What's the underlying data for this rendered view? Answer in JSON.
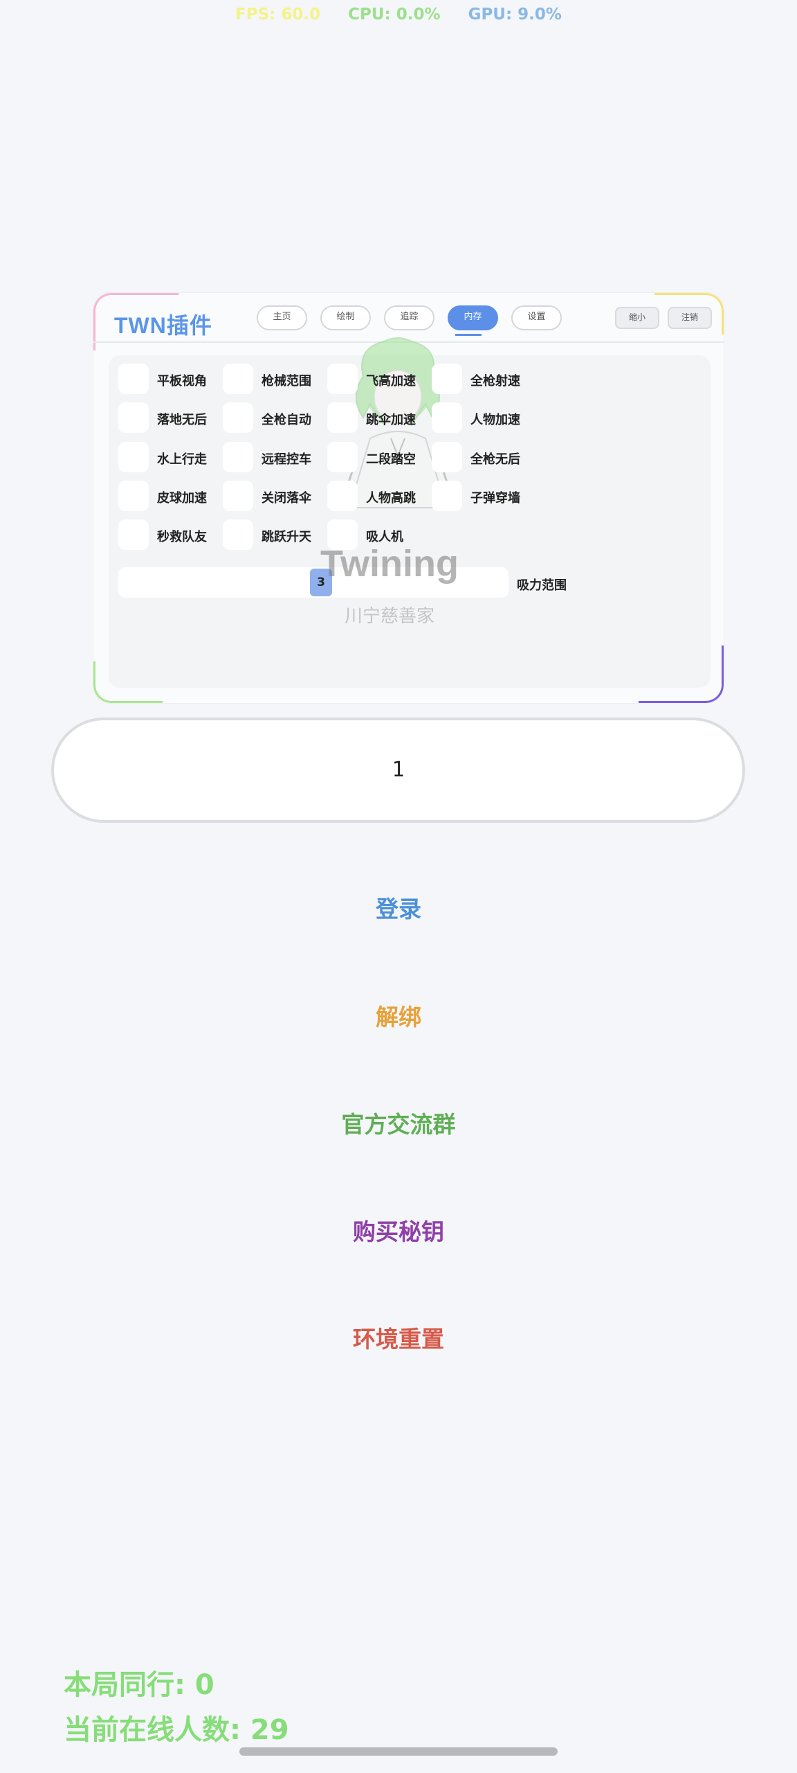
{
  "stats": {
    "fps": "FPS: 60.0",
    "cpu": "CPU: 0.0%",
    "gpu": "GPU: 9.0%"
  },
  "panel": {
    "logo": "TWN插件",
    "tabs": [
      "主页",
      "绘制",
      "追踪",
      "内存",
      "设置"
    ],
    "active_tab": "内存",
    "minimize_label": "缩小",
    "logout_label": "注销",
    "features": [
      [
        "平板视角",
        "枪械范围",
        "飞高加速",
        "全枪射速"
      ],
      [
        "落地无后",
        "全枪自动",
        "跳伞加速",
        "人物加速"
      ],
      [
        "水上行走",
        "远程控车",
        "二段踏空",
        "全枪无后"
      ],
      [
        "皮球加速",
        "关闭落伞",
        "人物高跳",
        "子弹穿墙"
      ],
      [
        "秒救队友",
        "跳跃升天",
        "吸人机"
      ]
    ],
    "slider": {
      "value": "3",
      "label": "吸力范围",
      "fraction": 0.52
    },
    "watermark": {
      "title": "Twining",
      "subtitle": "川宁慈善家"
    }
  },
  "key_input": {
    "value": "1"
  },
  "actions": [
    {
      "label": "登录",
      "color": "#4a90d9"
    },
    {
      "label": "解绑",
      "color": "#e8a13a"
    },
    {
      "label": "官方交流群",
      "color": "#5fae55"
    },
    {
      "label": "购买秘钥",
      "color": "#8e3fa8"
    },
    {
      "label": "环境重置",
      "color": "#d65a4a"
    }
  ],
  "footer": {
    "same_game": "本局同行: 0",
    "online_count": "当前在线人数: 29"
  },
  "colors": {
    "accent": "#5b8fe8",
    "footer_green": "#86dd79"
  }
}
